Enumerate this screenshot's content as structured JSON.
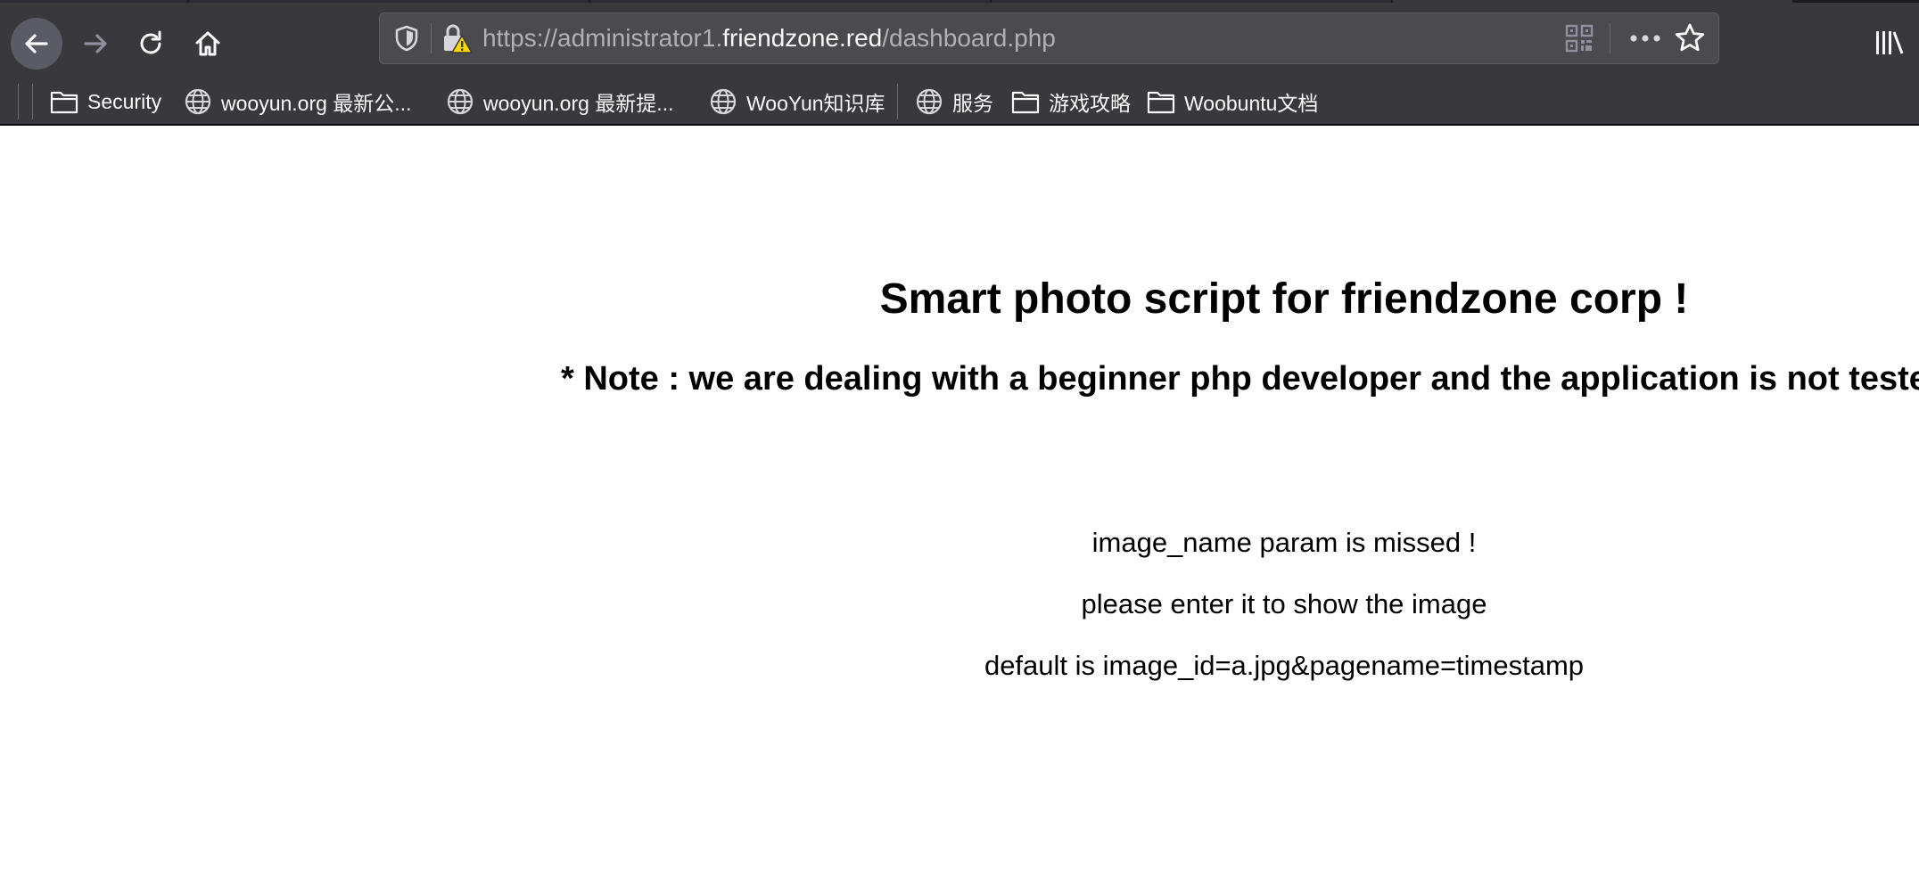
{
  "toolbar": {
    "back_icon": "arrow-left-icon",
    "forward_icon": "arrow-right-icon",
    "reload_icon": "reload-icon",
    "home_icon": "home-icon"
  },
  "urlbar": {
    "scheme_prefix": "https://administrator1.",
    "host": "friendzone.red",
    "path": "/dashboard.php",
    "shield_icon": "tracking-protection-shield-icon",
    "lock_icon": "insecure-lock-warning-icon",
    "qr_icon": "qr-code-icon",
    "more_icon": "page-actions-ellipsis-icon",
    "bookmark_icon": "star-icon"
  },
  "library_icon": "library-icon",
  "bookmarks": [
    {
      "label": "Security",
      "icon": "folder-icon"
    },
    {
      "label": "wooyun.org 最新公...",
      "icon": "globe-icon"
    },
    {
      "label": "wooyun.org 最新提...",
      "icon": "globe-icon"
    },
    {
      "label": "WooYun知识库",
      "icon": "globe-icon"
    },
    {
      "label": "服务",
      "icon": "globe-icon"
    },
    {
      "label": "游戏攻略",
      "icon": "folder-icon"
    },
    {
      "label": "Woobuntu文档",
      "icon": "folder-icon"
    }
  ],
  "page": {
    "title": "Smart photo script for friendzone corp !",
    "note": "* Note : we are dealing with a beginner php developer and the application is not tested",
    "messages": [
      "image_name param is missed !",
      "please enter it to show the image",
      "default is image_id=a.jpg&pagename=timestamp"
    ]
  },
  "colors": {
    "chrome_bg": "#38383d",
    "urlbar_bg": "#4a4a4f",
    "url_text_dim": "#b1b1b3",
    "url_text_host": "#f9f9fa",
    "page_bg": "#ffffff",
    "warning_yellow": "#ffd500"
  }
}
